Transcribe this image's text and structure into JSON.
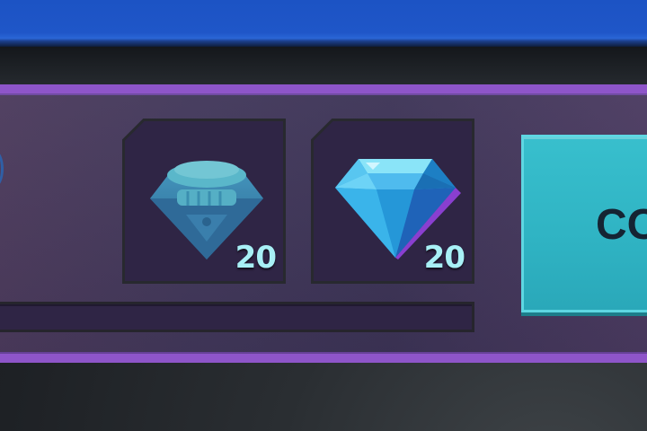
{
  "rewards": {
    "slots": [
      {
        "item": "gem",
        "state": "claimed",
        "quantity": "20"
      },
      {
        "item": "gem",
        "state": "available",
        "quantity": "20"
      }
    ]
  },
  "progress": {
    "fraction": 0
  },
  "collect_button": {
    "label": "CO"
  },
  "colors": {
    "panel_border": "#8e55c9",
    "panel_bg": "#41375a",
    "button": "#32b8c8",
    "gem": "#2fa5e4",
    "quantity_text": "#a8f0f6",
    "top_bar": "#1f56c8"
  }
}
